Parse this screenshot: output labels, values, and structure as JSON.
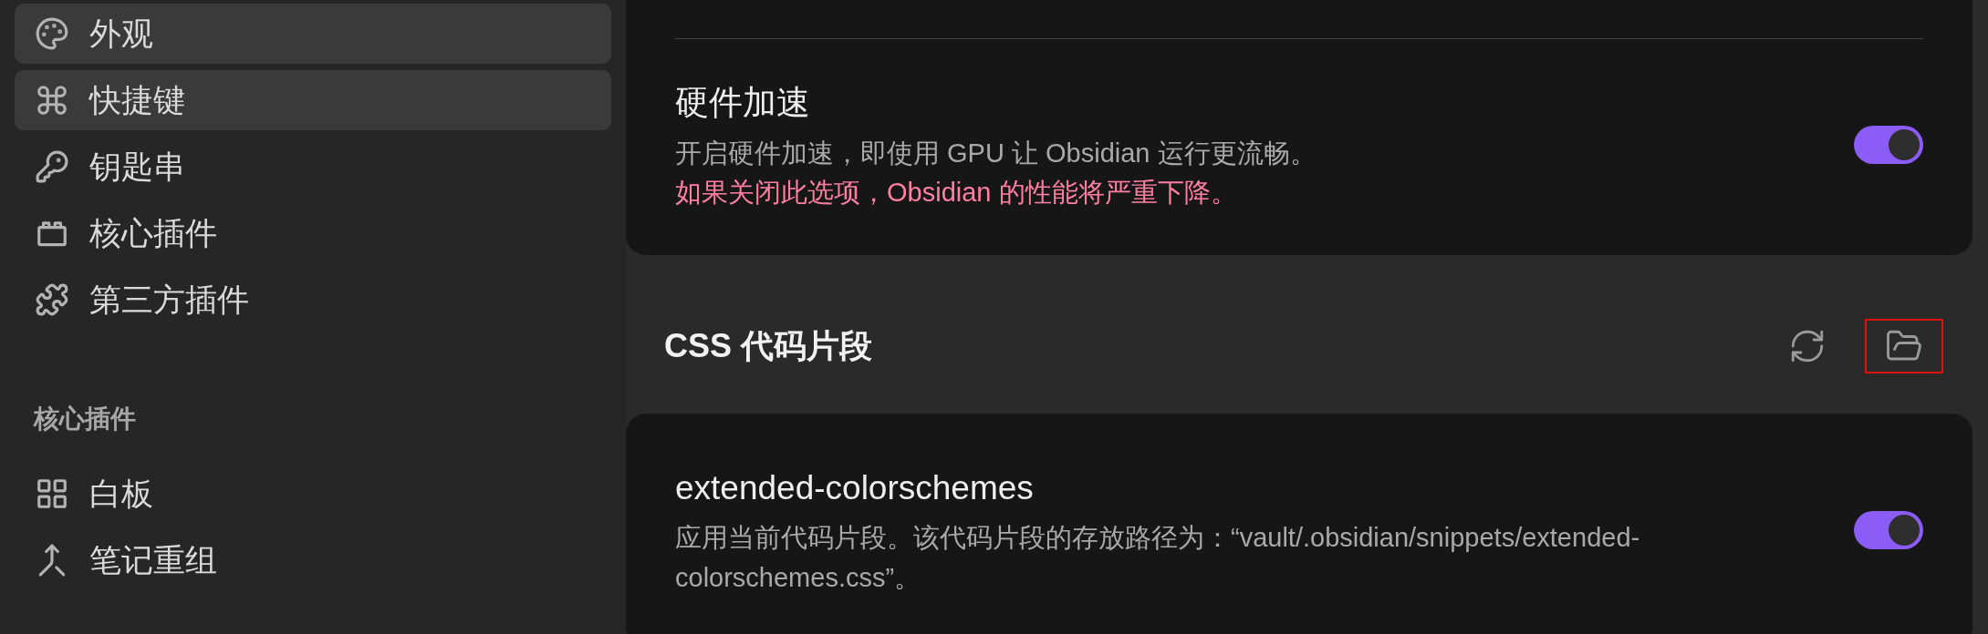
{
  "sidebar": {
    "items": [
      {
        "label": "外观",
        "selected": true
      },
      {
        "label": "快捷键",
        "selected": true
      },
      {
        "label": "钥匙串",
        "selected": false
      },
      {
        "label": "核心插件",
        "selected": false
      },
      {
        "label": "第三方插件",
        "selected": false
      }
    ],
    "sections": [
      {
        "heading": "核心插件",
        "items": [
          {
            "label": "白板",
            "selected": false
          },
          {
            "label": "笔记重组",
            "selected": false
          }
        ]
      }
    ]
  },
  "settings_card": {
    "items": [
      {
        "title": "硬件加速",
        "description": "开启硬件加速，即使用 GPU 让 Obsidian 运行更流畅。",
        "warning": "如果关闭此选项，Obsidian 的性能将严重下降。",
        "on": true
      }
    ]
  },
  "snippets": {
    "heading": "CSS 代码片段",
    "buttons": [
      {
        "highlighted": false
      },
      {
        "highlighted": true
      }
    ],
    "items": [
      {
        "title": "extended-colorschemes",
        "description": "应用当前代码片段。该代码片段的存放路径为：“vault/.obsidian/snippets/extended-colorschemes.css”。",
        "on": true
      }
    ]
  }
}
